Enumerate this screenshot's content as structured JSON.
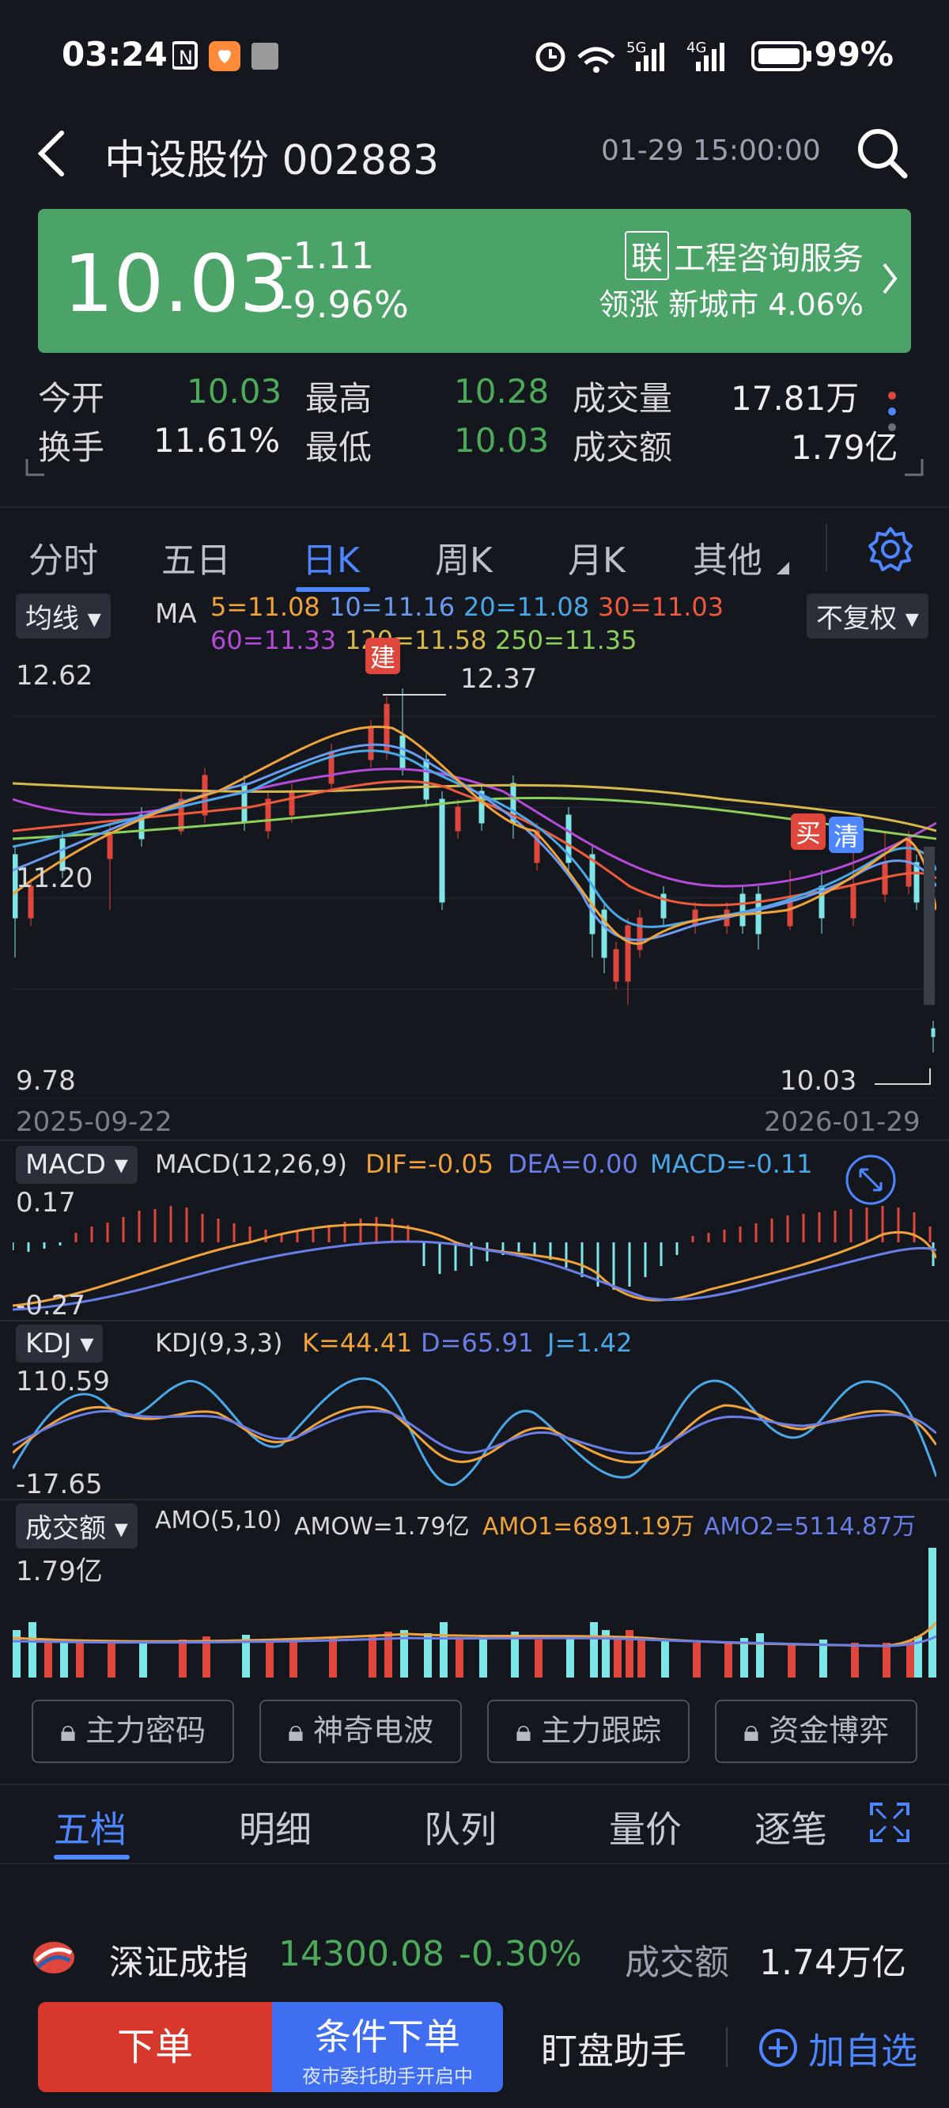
{
  "status_bar": {
    "time": "03:24",
    "battery": "99%"
  },
  "header": {
    "title": "中设股份 002883",
    "datetime": "01-29 15:00:00"
  },
  "quote": {
    "price": "10.03",
    "change": "-1.11",
    "change_pct": "-9.96%",
    "industry_tag": "联",
    "industry": "工程咨询服务",
    "leader_label": "领涨",
    "leader": "新城市 4.06%"
  },
  "stats": {
    "open_label": "今开",
    "open": "10.03",
    "high_label": "最高",
    "high": "10.28",
    "volume_label": "成交量",
    "volume": "17.81万",
    "turnover_label": "换手",
    "turnover": "11.61%",
    "low_label": "最低",
    "low": "10.03",
    "amount_label": "成交额",
    "amount": "1.79亿"
  },
  "period_tabs": [
    "分时",
    "五日",
    "日K",
    "周K",
    "月K",
    "其他"
  ],
  "active_tab": "日K",
  "ma": {
    "selector": "均线",
    "label": "MA",
    "adjust": "不复权",
    "ma5": "5=11.08",
    "ma10": "10=11.16",
    "ma20": "20=11.08",
    "ma30": "30=11.03",
    "ma60": "60=11.33",
    "ma120": "120=11.58",
    "ma250": "250=11.35",
    "ytop": "12.62",
    "ymid": "11.20",
    "ybot": "9.78",
    "max_marker": "12.37",
    "min_marker": "10.03",
    "date_start": "2025-09-22",
    "date_end": "2026-01-29",
    "tag_jian": "建",
    "tag_mai": "买",
    "tag_qing": "清"
  },
  "macd": {
    "selector": "MACD",
    "params": "MACD(12,26,9)",
    "dif": "DIF=-0.05",
    "dea": "DEA=0.00",
    "macd": "MACD=-0.11",
    "ytop": "0.17",
    "ybot": "-0.27"
  },
  "kdj": {
    "selector": "KDJ",
    "params": "KDJ(9,3,3)",
    "k": "K=44.41",
    "d": "D=65.91",
    "j": "J=1.42",
    "ytop": "110.59",
    "ybot": "-17.65"
  },
  "amo": {
    "selector": "成交额",
    "params": "AMO(5,10)",
    "amow": "AMOW=1.79亿",
    "amo1": "AMO1=6891.19万",
    "amo2": "AMO2=5114.87万",
    "ytop": "1.79亿"
  },
  "lock_buttons": [
    "主力密码",
    "神奇电波",
    "主力跟踪",
    "资金博弈"
  ],
  "bottom_tabs": [
    "五档",
    "明细",
    "队列",
    "量价",
    "逐笔"
  ],
  "index": {
    "name": "深证成指",
    "value": "14300.08",
    "change": "-0.30%",
    "amount_label": "成交额",
    "amount": "1.74万亿"
  },
  "actions": {
    "order": "下单",
    "cond_order": "条件下单",
    "cond_sub": "夜市委托助手开启中",
    "watch": "盯盘助手",
    "add": "加自选"
  },
  "colors": {
    "up": "#e0473c",
    "down": "#7ee6e6",
    "green": "#4caa5a",
    "accent": "#4e86ff",
    "ma5": "#f0a23b",
    "ma10": "#6a9bf0",
    "ma20": "#4aa8e8",
    "ma30": "#ee5a3c",
    "ma60": "#b44ad8",
    "ma120": "#d8b84a",
    "ma250": "#8ccf5a"
  }
}
